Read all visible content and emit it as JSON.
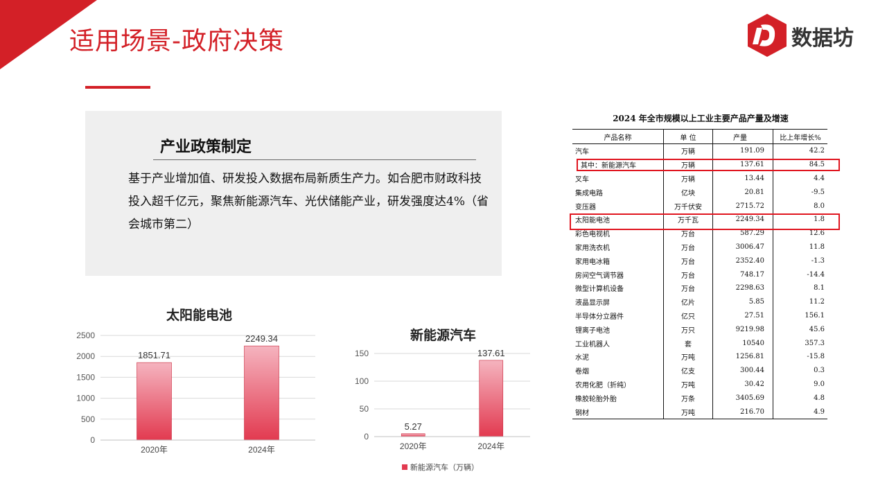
{
  "header": {
    "title": "适用场景-政府决策",
    "logo_text": "数据坊",
    "brand_color": "#d32027"
  },
  "policy_panel": {
    "heading": "产业政策制定",
    "body": "基于产业增加值、研发投入数据布局新质生产力。如合肥市财政科技投入超千亿元，聚焦新能源汽车、光伏储能产业，研发强度达4%（省会城市第二）"
  },
  "chart_data": [
    {
      "type": "bar",
      "title": "太阳能电池",
      "categories": [
        "2020年",
        "2024年"
      ],
      "values": [
        1851.71,
        2249.34
      ],
      "data_labels": [
        "1851.71",
        "2249.34"
      ],
      "ylim": [
        0,
        2500
      ],
      "yticks": [
        "0",
        "500",
        "1000",
        "1500",
        "2000",
        "2500"
      ],
      "grid": true,
      "bar_color": "#e23a50"
    },
    {
      "type": "bar",
      "title": "新能源汽车",
      "categories": [
        "2020年",
        "2024年"
      ],
      "series": [
        {
          "name": "新能源汽车（万辆）",
          "values": [
            5.27,
            137.61
          ]
        }
      ],
      "data_labels": [
        "5.27",
        "137.61"
      ],
      "ylim": [
        0,
        150
      ],
      "yticks": [
        "0",
        "50",
        "100",
        "150"
      ],
      "grid": true,
      "legend": "bottom",
      "bar_color": "#e23a50"
    }
  ],
  "table": {
    "title": "2024 年全市规模以上工业主要产品产量及增速",
    "headers": [
      "产品名称",
      "单 位",
      "产量",
      "比上年增长%"
    ],
    "rows": [
      [
        "汽车",
        "万辆",
        "191.09",
        "42.2"
      ],
      [
        "其中：新能源汽车",
        "万辆",
        "137.61",
        "84.5"
      ],
      [
        "叉车",
        "万辆",
        "13.44",
        "4.4"
      ],
      [
        "集成电路",
        "亿块",
        "20.81",
        "-9.5"
      ],
      [
        "变压器",
        "万千伏安",
        "2715.72",
        "8.0"
      ],
      [
        "太阳能电池",
        "万千瓦",
        "2249.34",
        "1.8"
      ],
      [
        "彩色电视机",
        "万台",
        "587.29",
        "12.6"
      ],
      [
        "家用洗衣机",
        "万台",
        "3006.47",
        "11.8"
      ],
      [
        "家用电冰箱",
        "万台",
        "2352.40",
        "-1.3"
      ],
      [
        "房间空气调节器",
        "万台",
        "748.17",
        "-14.4"
      ],
      [
        "微型计算机设备",
        "万台",
        "2298.63",
        "8.1"
      ],
      [
        "液晶显示屏",
        "亿片",
        "5.85",
        "11.2"
      ],
      [
        "半导体分立器件",
        "亿只",
        "27.51",
        "156.1"
      ],
      [
        "锂离子电池",
        "万只",
        "9219.98",
        "45.6"
      ],
      [
        "工业机器人",
        "套",
        "10540",
        "357.3"
      ],
      [
        "水泥",
        "万吨",
        "1256.81",
        "-15.8"
      ],
      [
        "卷烟",
        "亿支",
        "300.44",
        "0.3"
      ],
      [
        "农用化肥（折纯）",
        "万吨",
        "30.42",
        "9.0"
      ],
      [
        "橡胶轮胎外胎",
        "万条",
        "3405.69",
        "4.8"
      ],
      [
        "钢材",
        "万吨",
        "216.70",
        "4.9"
      ]
    ],
    "highlight_color": "#e0141e"
  }
}
